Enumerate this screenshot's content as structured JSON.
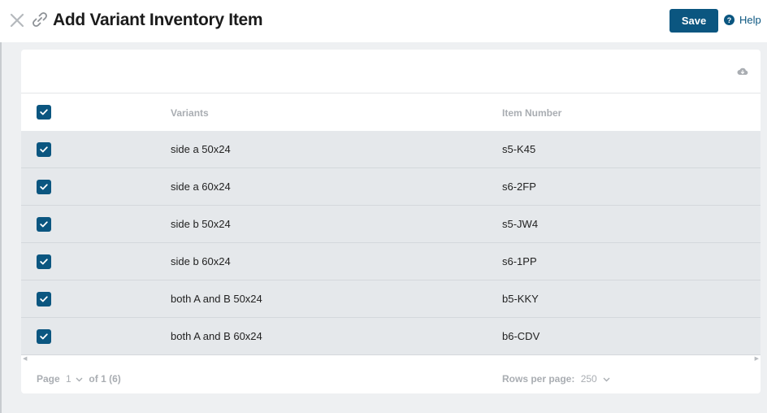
{
  "header": {
    "title": "Add Variant Inventory Item",
    "save_label": "Save",
    "help_label": "Help",
    "help_glyph": "?"
  },
  "table": {
    "columns": [
      "Variants",
      "Item Number"
    ],
    "rows": [
      {
        "variant": "side a 50x24",
        "item_number": "s5-K45",
        "checked": true
      },
      {
        "variant": "side a 60x24",
        "item_number": "s6-2FP",
        "checked": true
      },
      {
        "variant": "side b 50x24",
        "item_number": "s5-JW4",
        "checked": true
      },
      {
        "variant": "side b 60x24",
        "item_number": "s6-1PP",
        "checked": true
      },
      {
        "variant": "both A and B 50x24",
        "item_number": "b5-KKY",
        "checked": true
      },
      {
        "variant": "both A and B 60x24",
        "item_number": "b6-CDV",
        "checked": true
      }
    ],
    "select_all_checked": true
  },
  "footer": {
    "page_label": "Page",
    "page_number": "1",
    "page_of": "of 1 (6)",
    "rows_per_page_label": "Rows per page:",
    "rows_per_page_value": "250"
  },
  "colors": {
    "accent": "#0b5680",
    "row_bg": "#e5e8eb",
    "page_bg": "#eef0f2"
  },
  "icons": {
    "close": "close-icon",
    "link": "link-icon",
    "help": "help-icon",
    "cloud": "cloud-download-icon",
    "check": "check-icon",
    "chevron": "chevron-down-icon"
  }
}
